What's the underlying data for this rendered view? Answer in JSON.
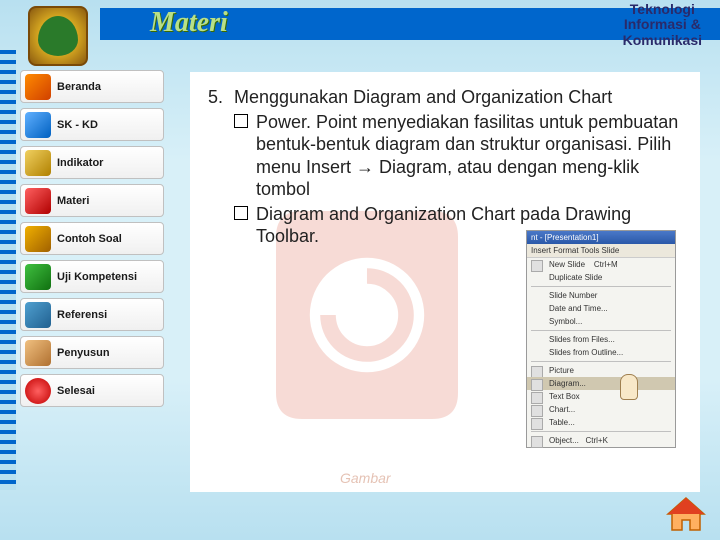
{
  "header": {
    "title": "Materi",
    "brand_line1": "Teknologi",
    "brand_line2": "Informasi &",
    "brand_line3": "Komunikasi"
  },
  "sidebar": {
    "items": [
      {
        "label": "Beranda"
      },
      {
        "label": "SK - KD"
      },
      {
        "label": "Indikator"
      },
      {
        "label": "Materi"
      },
      {
        "label": "Contoh Soal"
      },
      {
        "label": "Uji Kompetensi"
      },
      {
        "label": "Referensi"
      },
      {
        "label": "Penyusun"
      },
      {
        "label": "Selesai"
      }
    ]
  },
  "content": {
    "number": "5.",
    "heading": "Menggunakan Diagram and Organization Chart",
    "bullet1": "Power. Point menyediakan fasilitas untuk pembuatan bentuk-bentuk diagram dan struktur organisasi.  Pilih menu Insert → Diagram, atau dengan meng-klik tombol",
    "bullet2": "Diagram and Organization Chart  pada Drawing Toolbar.",
    "caption": "Gambar"
  },
  "menu": {
    "title": "nt - [Presentation1]",
    "bar": "Insert   Format   Tools   Slide",
    "items": [
      {
        "label": "New Slide",
        "shortcut": "Ctrl+M"
      },
      {
        "label": "Duplicate Slide"
      },
      {
        "label": "Slide Number"
      },
      {
        "label": "Date and Time..."
      },
      {
        "label": "Symbol..."
      },
      {
        "label": "Slides from Files..."
      },
      {
        "label": "Slides from Outline..."
      },
      {
        "label": "Picture"
      },
      {
        "label": "Diagram...",
        "hl": true
      },
      {
        "label": "Text Box"
      },
      {
        "label": "Chart..."
      },
      {
        "label": "Table..."
      },
      {
        "label": "Object...",
        "shortcut": "Ctrl+K"
      }
    ]
  }
}
